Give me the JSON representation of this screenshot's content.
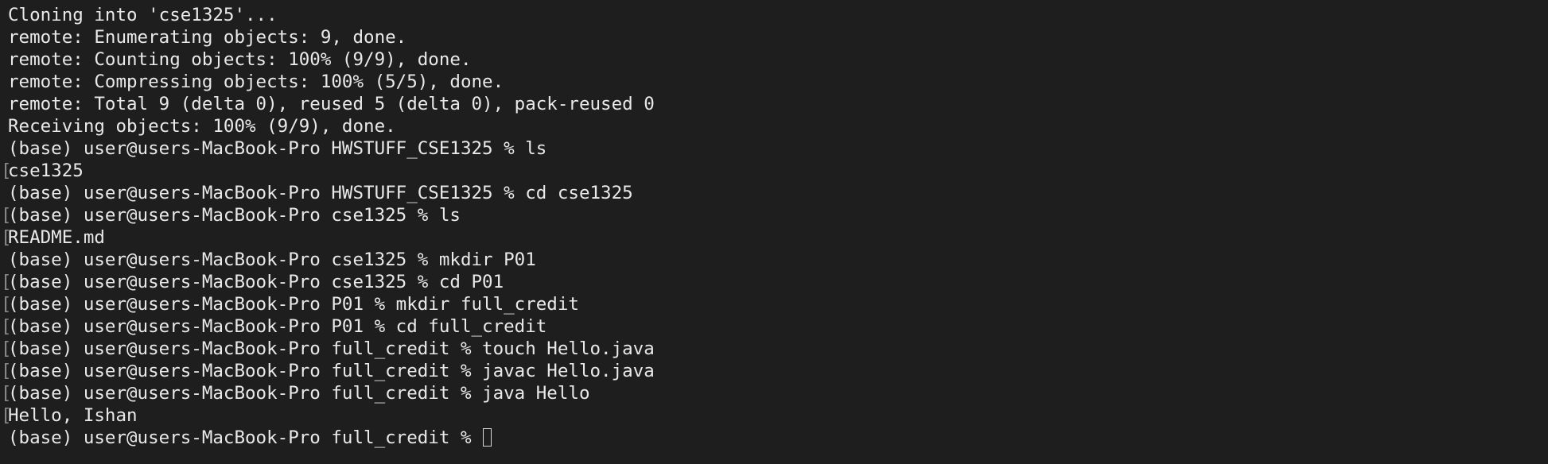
{
  "terminal": {
    "lines": [
      {
        "mark": "",
        "text": "Cloning into 'cse1325'..."
      },
      {
        "mark": "",
        "text": "remote: Enumerating objects: 9, done."
      },
      {
        "mark": "",
        "text": "remote: Counting objects: 100% (9/9), done."
      },
      {
        "mark": "",
        "text": "remote: Compressing objects: 100% (5/5), done."
      },
      {
        "mark": "",
        "text": "remote: Total 9 (delta 0), reused 5 (delta 0), pack-reused 0"
      },
      {
        "mark": "",
        "text": "Receiving objects: 100% (9/9), done."
      },
      {
        "mark": "",
        "text": "(base) user@users-MacBook-Pro HWSTUFF_CSE1325 % ls"
      },
      {
        "mark": "[",
        "text": "cse1325"
      },
      {
        "mark": "",
        "text": "(base) user@users-MacBook-Pro HWSTUFF_CSE1325 % cd cse1325"
      },
      {
        "mark": "[",
        "text": "(base) user@users-MacBook-Pro cse1325 % ls"
      },
      {
        "mark": "[",
        "text": "README.md"
      },
      {
        "mark": "",
        "text": "(base) user@users-MacBook-Pro cse1325 % mkdir P01"
      },
      {
        "mark": "[",
        "text": "(base) user@users-MacBook-Pro cse1325 % cd P01"
      },
      {
        "mark": "[",
        "text": "(base) user@users-MacBook-Pro P01 % mkdir full_credit"
      },
      {
        "mark": "[",
        "text": "(base) user@users-MacBook-Pro P01 % cd full_credit"
      },
      {
        "mark": "[",
        "text": "(base) user@users-MacBook-Pro full_credit % touch Hello.java"
      },
      {
        "mark": "[",
        "text": "(base) user@users-MacBook-Pro full_credit % javac Hello.java"
      },
      {
        "mark": "[",
        "text": "(base) user@users-MacBook-Pro full_credit % java Hello"
      },
      {
        "mark": "[",
        "text": "Hello, Ishan"
      },
      {
        "mark": "",
        "text": "(base) user@users-MacBook-Pro full_credit % "
      }
    ]
  },
  "colors": {
    "background": "#1e1e1e",
    "foreground": "#e9e9e9",
    "mark": "#8a8a8a"
  }
}
